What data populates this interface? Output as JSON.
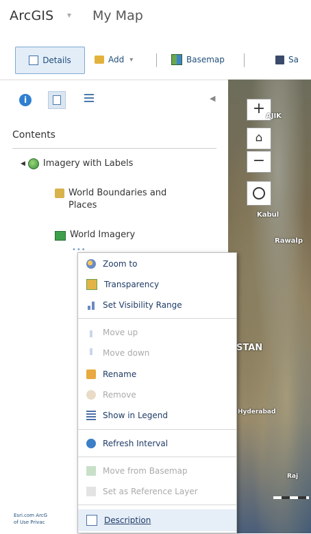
{
  "app": {
    "brand": "ArcGIS",
    "map_title": "My Map"
  },
  "toolbar": {
    "details_label": "Details",
    "add_label": "Add",
    "basemap_label": "Basemap",
    "save_label": "Sa"
  },
  "panel": {
    "contents_label": "Contents",
    "layers": [
      {
        "label": "Imagery with Labels"
      },
      {
        "label": "World Boundaries and Places"
      },
      {
        "label": "World Imagery"
      }
    ],
    "footer": {
      "line1": "Esri.com  ArcG",
      "line2": "of Use  Privac"
    }
  },
  "map": {
    "labels": {
      "ajik": "AJIK",
      "kabul": "Kabul",
      "rawal": "Rawalp",
      "stan": "STAN",
      "hyderabad": "Hyderabad",
      "raj": "Raj"
    }
  },
  "context_menu": {
    "items": [
      {
        "label": "Zoom to",
        "icon": "zoom-to-icon",
        "enabled": true
      },
      {
        "label": "Transparency",
        "icon": "transparency-icon",
        "enabled": true
      },
      {
        "label": "Set Visibility Range",
        "icon": "visibility-range-icon",
        "enabled": true
      },
      {
        "label": "Move up",
        "icon": "move-up-icon",
        "enabled": false
      },
      {
        "label": "Move down",
        "icon": "move-down-icon",
        "enabled": false
      },
      {
        "label": "Rename",
        "icon": "rename-icon",
        "enabled": true
      },
      {
        "label": "Remove",
        "icon": "remove-icon",
        "enabled": false
      },
      {
        "label": "Show in Legend",
        "icon": "legend-icon",
        "enabled": true
      },
      {
        "label": "Refresh Interval",
        "icon": "refresh-icon",
        "enabled": true
      },
      {
        "label": "Move from Basemap",
        "icon": "move-from-basemap-icon",
        "enabled": false
      },
      {
        "label": "Set as Reference Layer",
        "icon": "reference-layer-icon",
        "enabled": false
      },
      {
        "label": "Description",
        "icon": "description-icon",
        "enabled": true,
        "selected": true
      }
    ]
  }
}
